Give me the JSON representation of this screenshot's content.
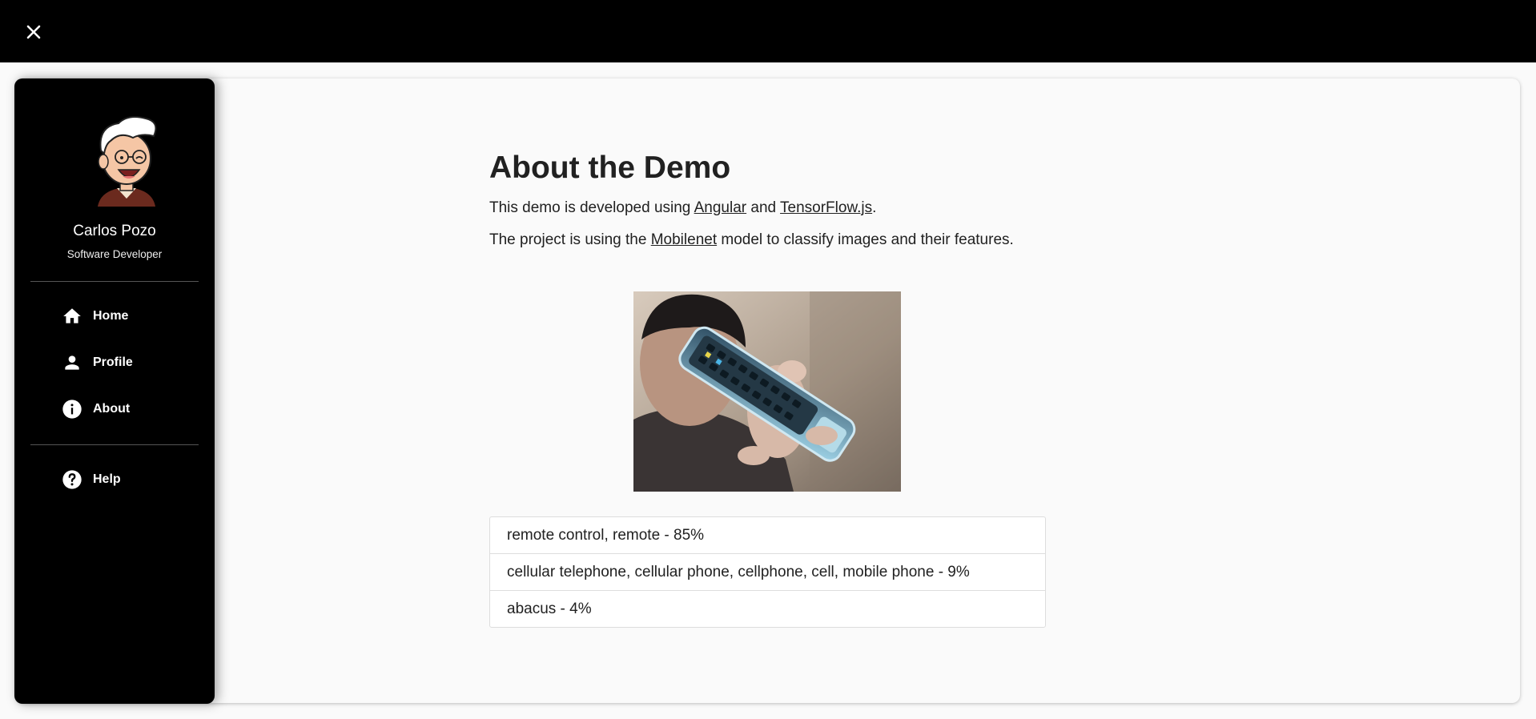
{
  "sidebar": {
    "user_name": "Carlos Pozo",
    "user_role": "Software Developer",
    "nav_items": [
      {
        "label": "Home",
        "icon": "home-icon"
      },
      {
        "label": "Profile",
        "icon": "person-icon"
      },
      {
        "label": "About",
        "icon": "info-icon"
      }
    ],
    "help_item": {
      "label": "Help",
      "icon": "help-icon"
    }
  },
  "main": {
    "title": "About the Demo",
    "intro": {
      "text_before": "This demo is developed using ",
      "link1": "Angular",
      "text_middle": " and ",
      "link2": "TensorFlow.js",
      "text_after": "."
    },
    "model_line": {
      "text_before": "The project is using the ",
      "link": "Mobilenet",
      "text_after": " model to classify images and their features."
    },
    "predictions": [
      "remote control, remote - 85%",
      "cellular telephone, cellular phone, cellphone, cell, mobile phone - 9%",
      "abacus - 4%"
    ]
  },
  "colors": {
    "topbar": "#000000",
    "sidebar": "#000000",
    "background": "#fafafa",
    "text": "#212121"
  }
}
